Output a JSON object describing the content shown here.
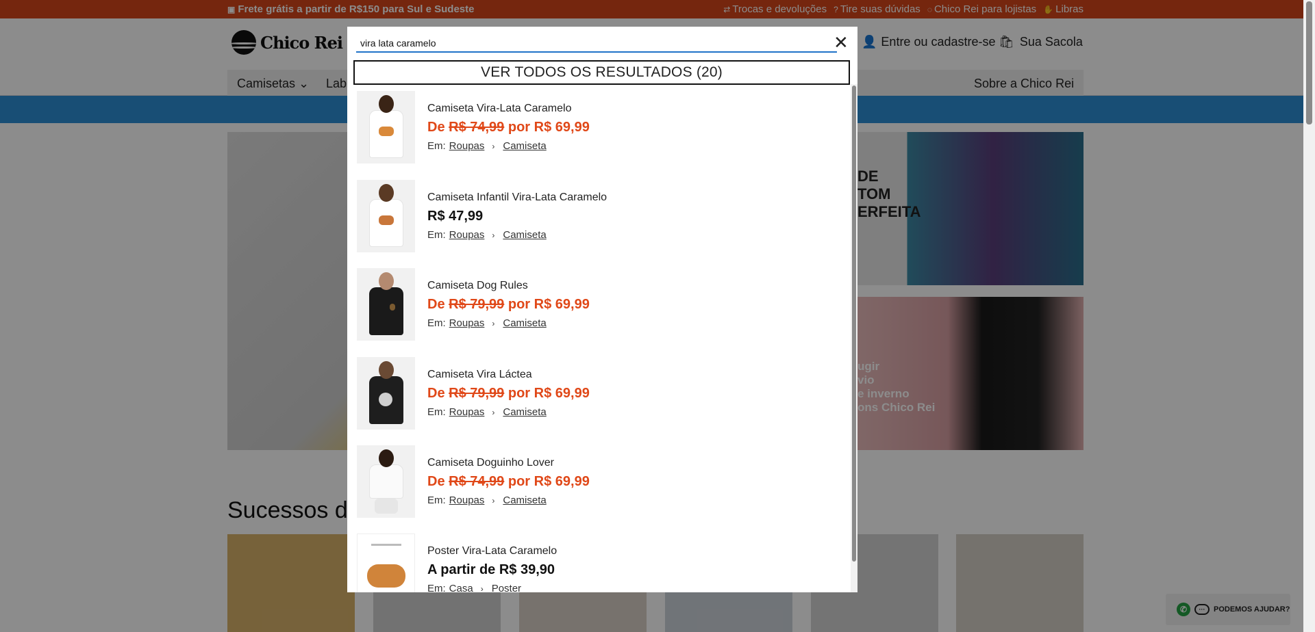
{
  "topbar": {
    "promo": "Frete grátis a partir de R$150 para Sul e Sudeste",
    "links": [
      "Trocas e devoluções",
      "Tire suas dúvidas",
      "Chico Rei para lojistas",
      "Libras"
    ]
  },
  "header": {
    "logo": "Chico Rei",
    "account": "Entre ou cadastre-se",
    "bag": "Sua Sacola"
  },
  "nav": {
    "items": [
      "Camisetas",
      "Lab"
    ],
    "about": "Sobre a Chico Rei"
  },
  "banners": {
    "right1_text": "DE\nTOM\nERFEITA",
    "right2_text": "ugir\nvio\ne inverno\nons Chico Rei"
  },
  "section_title": "Sucessos da",
  "whatsapp": {
    "label": "PODEMOS AJUDAR?"
  },
  "search": {
    "query": "vira lata caramelo",
    "see_all": "VER TODOS OS RESULTADOS (20)",
    "category_prefix": "Em:",
    "results": [
      {
        "name": "Camiseta Vira-Lata Caramelo",
        "price_prefix": "De ",
        "old_price": "R$ 74,99",
        "price_mid": " por ",
        "price": "R$ 69,99",
        "sale": true,
        "cat1": "Roupas",
        "cat2": "Camiseta"
      },
      {
        "name": "Camiseta Infantil Vira-Lata Caramelo",
        "price_prefix": "",
        "old_price": "",
        "price_mid": "",
        "price": "R$ 47,99",
        "sale": false,
        "cat1": "Roupas",
        "cat2": "Camiseta"
      },
      {
        "name": "Camiseta Dog Rules",
        "price_prefix": "De ",
        "old_price": "R$ 79,99",
        "price_mid": " por ",
        "price": "R$ 69,99",
        "sale": true,
        "cat1": "Roupas",
        "cat2": "Camiseta"
      },
      {
        "name": "Camiseta Vira Láctea",
        "price_prefix": "De ",
        "old_price": "R$ 79,99",
        "price_mid": " por ",
        "price": "R$ 69,99",
        "sale": true,
        "cat1": "Roupas",
        "cat2": "Camiseta"
      },
      {
        "name": "Camiseta Doguinho Lover",
        "price_prefix": "De ",
        "old_price": "R$ 74,99",
        "price_mid": " por ",
        "price": "R$ 69,99",
        "sale": true,
        "cat1": "Roupas",
        "cat2": "Camiseta"
      },
      {
        "name": "Poster Vira-Lata Caramelo",
        "price_prefix": "",
        "old_price": "",
        "price_mid": "",
        "price": "A partir de R$ 39,90",
        "sale": false,
        "cat1": "Casa",
        "cat2": "Poster"
      }
    ]
  },
  "colors": {
    "topbar": "#d5461a",
    "sale": "#e04818",
    "input_underline": "#1f72c8",
    "blue_bar": "#2c8ed6"
  }
}
